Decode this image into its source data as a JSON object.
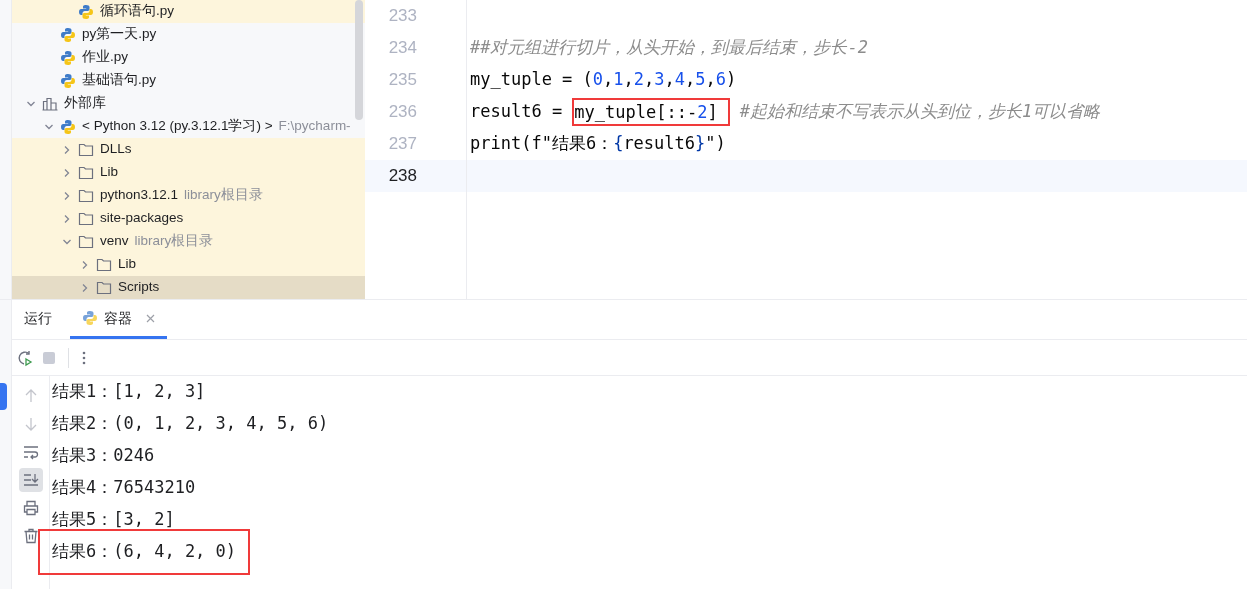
{
  "project_tree": [
    {
      "children": [
        {
          "children": [
            {
              "label": "循环语句.py",
              "kind": "python-file",
              "highlighted": true,
              "selected": false
            }
          ]
        },
        {
          "label": "py第一天.py",
          "kind": "python-file",
          "highlighted": false,
          "selected": false
        },
        {
          "label": "作业.py",
          "kind": "python-file",
          "highlighted": false,
          "selected": false
        },
        {
          "label": "基础语句.py",
          "kind": "python-file",
          "highlighted": false,
          "selected": false
        }
      ]
    },
    {
      "label": "外部库",
      "kind": "library",
      "expanded": true,
      "highlighted": false,
      "selected": false,
      "children": [
        {
          "label": "< Python 3.12 (py.3.12.1学习) >",
          "hint": "F:\\pycharm-",
          "kind": "python-file",
          "expanded": true,
          "highlighted": false,
          "selected": false,
          "children": [
            {
              "label": "DLLs",
              "kind": "folder",
              "expanded": false,
              "highlighted": true,
              "selected": false
            },
            {
              "label": "Lib",
              "kind": "folder",
              "expanded": false,
              "highlighted": true,
              "selected": false
            },
            {
              "label": "python3.12.1",
              "hint": "library根目录",
              "kind": "folder",
              "expanded": false,
              "highlighted": true,
              "selected": false
            },
            {
              "label": "site-packages",
              "kind": "folder",
              "expanded": false,
              "highlighted": true,
              "selected": false
            },
            {
              "label": "venv",
              "hint": "library根目录",
              "kind": "folder",
              "expanded": true,
              "highlighted": true,
              "selected": false,
              "children": [
                {
                  "label": "Lib",
                  "kind": "folder",
                  "expanded": false,
                  "highlighted": true,
                  "selected": false
                },
                {
                  "label": "Scripts",
                  "kind": "folder",
                  "expanded": false,
                  "highlighted": true,
                  "selected": true
                }
              ]
            }
          ]
        }
      ]
    }
  ],
  "editor": {
    "lines": [
      {
        "number": "233",
        "current": false
      },
      {
        "number": "234",
        "current": false,
        "tokens": [
          {
            "text": "##对元组进行切片，从头开始，到最后结束，步长-2",
            "kind": "comment"
          }
        ]
      },
      {
        "number": "235",
        "current": false,
        "tokens": [
          {
            "text": "my_tuple = (",
            "kind": "plain"
          },
          {
            "text": "0",
            "kind": "number"
          },
          {
            "text": ",",
            "kind": "plain"
          },
          {
            "text": "1",
            "kind": "number"
          },
          {
            "text": ",",
            "kind": "plain"
          },
          {
            "text": "2",
            "kind": "number"
          },
          {
            "text": ",",
            "kind": "plain"
          },
          {
            "text": "3",
            "kind": "number"
          },
          {
            "text": ",",
            "kind": "plain"
          },
          {
            "text": "4",
            "kind": "number"
          },
          {
            "text": ",",
            "kind": "plain"
          },
          {
            "text": "5",
            "kind": "number"
          },
          {
            "text": ",",
            "kind": "plain"
          },
          {
            "text": "6",
            "kind": "number"
          },
          {
            "text": ")",
            "kind": "plain"
          }
        ]
      },
      {
        "number": "236",
        "current": false,
        "tokens": [
          {
            "text": "result6 = ",
            "kind": "plain"
          },
          {
            "kind": "boxed",
            "parts": [
              {
                "text": "my_tuple[::-",
                "kind": "plain"
              },
              {
                "text": "2",
                "kind": "number"
              },
              {
                "text": "]",
                "kind": "plain"
              }
            ]
          },
          {
            "text": "#起始和结束不写表示从头到位，步长1可以省略",
            "kind": "comment"
          }
        ]
      },
      {
        "number": "237",
        "current": false,
        "tokens": [
          {
            "text": "print(f\"结果6：",
            "kind": "plain"
          },
          {
            "text": "{",
            "kind": "brace"
          },
          {
            "text": "result6",
            "kind": "plain"
          },
          {
            "text": "}",
            "kind": "brace"
          },
          {
            "text": "\")",
            "kind": "plain"
          }
        ]
      },
      {
        "number": "238",
        "current": true
      }
    ]
  },
  "run_panel": {
    "tabs": [
      {
        "label": "运行",
        "kind": "text",
        "selected": false
      },
      {
        "label": "容器",
        "kind": "run-config",
        "selected": true
      }
    ],
    "tools": [
      {
        "kind": "up",
        "disabled": true,
        "on": false
      },
      {
        "kind": "down",
        "disabled": true,
        "on": false
      },
      {
        "kind": "wrap",
        "disabled": false,
        "on": false
      },
      {
        "kind": "scroll-end",
        "disabled": false,
        "on": true
      },
      {
        "kind": "print",
        "disabled": false,
        "on": false
      },
      {
        "kind": "clear",
        "disabled": false,
        "on": false
      }
    ],
    "output": [
      {
        "text": "结果1：[1, 2, 3]",
        "boxed": false
      },
      {
        "text": "结果2：(0, 1, 2, 3, 4, 5, 6)",
        "boxed": false
      },
      {
        "text": "结果3：0246",
        "boxed": false
      },
      {
        "text": "结果4：76543210",
        "boxed": false
      },
      {
        "text": "结果5：[3, 2]",
        "boxed": false
      },
      {
        "text": "结果6：(6, 4, 2, 0)",
        "boxed": true
      }
    ]
  }
}
